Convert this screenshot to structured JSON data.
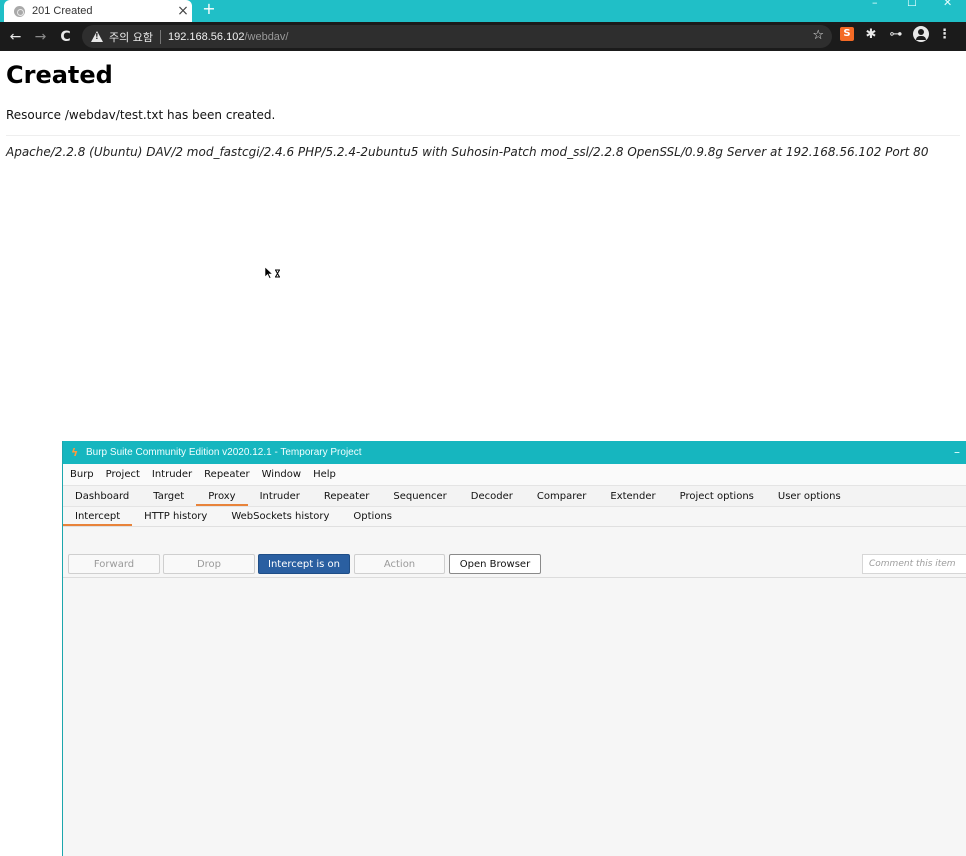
{
  "browser": {
    "tab_title": "201 Created",
    "tab_close": "×",
    "new_tab": "+",
    "window_controls": [
      "–",
      "☐",
      "✕"
    ],
    "security_label": "주의 요함",
    "url_host": "192.168.56.102",
    "url_path": "/webdav/",
    "nav": {
      "back": "←",
      "forward": "→",
      "reload": "C"
    },
    "bookmark_icon": "☆",
    "extensions": {
      "burp": "S",
      "puzzle": "✱",
      "key": "⊶"
    },
    "menu": "⋮"
  },
  "page": {
    "heading": "Created",
    "message": "Resource /webdav/test.txt has been created.",
    "address": "Apache/2.2.8 (Ubuntu) DAV/2 mod_fastcgi/2.4.6 PHP/5.2.4-2ubuntu5 with Suhosin-Patch mod_ssl/2.2.8 OpenSSL/0.9.8g Server at 192.168.56.102 Port 80"
  },
  "burp": {
    "logo": "ϟ",
    "title": "Burp Suite Community Edition v2020.12.1 - Temporary Project",
    "minimize": "–",
    "menu": [
      "Burp",
      "Project",
      "Intruder",
      "Repeater",
      "Window",
      "Help"
    ],
    "main_tabs": [
      {
        "label": "Dashboard",
        "active": false
      },
      {
        "label": "Target",
        "active": false
      },
      {
        "label": "Proxy",
        "active": true
      },
      {
        "label": "Intruder",
        "active": false
      },
      {
        "label": "Repeater",
        "active": false
      },
      {
        "label": "Sequencer",
        "active": false
      },
      {
        "label": "Decoder",
        "active": false
      },
      {
        "label": "Comparer",
        "active": false
      },
      {
        "label": "Extender",
        "active": false
      },
      {
        "label": "Project options",
        "active": false
      },
      {
        "label": "User options",
        "active": false
      }
    ],
    "sub_tabs": [
      {
        "label": "Intercept",
        "active": true
      },
      {
        "label": "HTTP history",
        "active": false
      },
      {
        "label": "WebSockets history",
        "active": false
      },
      {
        "label": "Options",
        "active": false
      }
    ],
    "buttons": {
      "forward": "Forward",
      "drop": "Drop",
      "intercept": "Intercept is on",
      "action": "Action",
      "open_browser": "Open Browser"
    },
    "comment_placeholder": "Comment this item"
  },
  "colors": {
    "titlebar": "#16b6bf",
    "accent_tab": "#e8833a",
    "intercept_button": "#2a5fa1"
  }
}
